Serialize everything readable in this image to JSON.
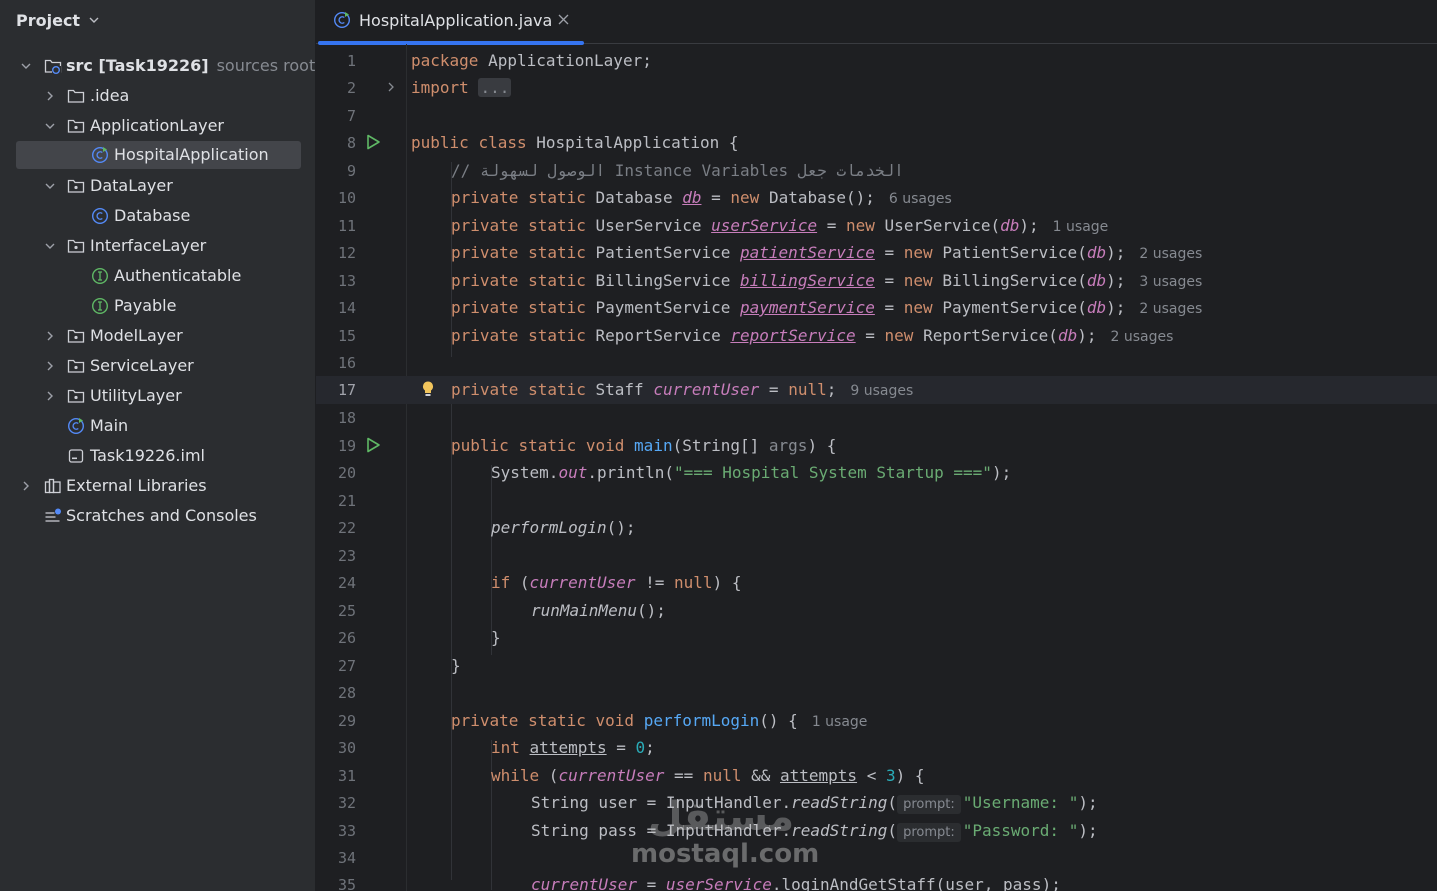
{
  "project_panel": {
    "title": "Project",
    "tree": [
      {
        "label": "src [Task19226]",
        "hint": "sources root,",
        "icon": "source-root-folder-icon",
        "expanded": true
      },
      {
        "label": ".idea",
        "icon": "folder-icon",
        "expanded": false
      },
      {
        "label": "ApplicationLayer",
        "icon": "package-folder-icon",
        "expanded": true
      },
      {
        "label": "HospitalApplication",
        "icon": "java-class-icon",
        "selected": true
      },
      {
        "label": "DataLayer",
        "icon": "package-folder-icon",
        "expanded": true
      },
      {
        "label": "Database",
        "icon": "java-class-icon"
      },
      {
        "label": "InterfaceLayer",
        "icon": "package-folder-icon",
        "expanded": true
      },
      {
        "label": "Authenticatable",
        "icon": "java-interface-icon"
      },
      {
        "label": "Payable",
        "icon": "java-interface-icon"
      },
      {
        "label": "ModelLayer",
        "icon": "package-folder-icon",
        "expanded": false
      },
      {
        "label": "ServiceLayer",
        "icon": "package-folder-icon",
        "expanded": false
      },
      {
        "label": "UtilityLayer",
        "icon": "package-folder-icon",
        "expanded": false
      },
      {
        "label": "Main",
        "icon": "java-main-class-icon"
      },
      {
        "label": "Task19226.iml",
        "icon": "iml-file-icon"
      },
      {
        "label": "External Libraries",
        "icon": "libraries-icon",
        "expanded": false
      },
      {
        "label": "Scratches and Consoles",
        "icon": "scratches-icon"
      }
    ]
  },
  "editor": {
    "tab_label": "HospitalApplication.java",
    "current_line": "17",
    "line_numbers": [
      "1",
      "2",
      "7",
      "8",
      "9",
      "10",
      "11",
      "12",
      "13",
      "14",
      "15",
      "16",
      "17",
      "18",
      "19",
      "20",
      "21",
      "22",
      "23",
      "24",
      "25",
      "26",
      "27",
      "28",
      "29",
      "30",
      "31",
      "32",
      "33",
      "34",
      "35"
    ],
    "code": {
      "package_kw": "package",
      "package_name": "ApplicationLayer;",
      "import_kw": "import",
      "import_fold": "...",
      "l8_public": "public",
      "l8_class": "class",
      "l8_name": "HospitalApplication {",
      "l9_comment": "// الوصول لسهولة Instance Variables الخدمات جعل",
      "private": "private",
      "static": "static",
      "new": "new",
      "l10_type": "Database",
      "l10_var": "db",
      "l10_eq": " = ",
      "l10_call": "Database();",
      "l10_hint": "6 usages",
      "l11_type": "UserService",
      "l11_var": "userService",
      "l11_call": "UserService(",
      "l11_arg": "db",
      "l11_end": ");",
      "l11_hint": "1 usage",
      "l12_type": "PatientService",
      "l12_var": "patientService",
      "l12_call": "PatientService(",
      "l12_arg": "db",
      "l12_end": ");",
      "l12_hint": "2 usages",
      "l13_type": "BillingService",
      "l13_var": "billingService",
      "l13_call": "BillingService(",
      "l13_arg": "db",
      "l13_end": ");",
      "l13_hint": "3 usages",
      "l14_type": "PaymentService",
      "l14_var": "paymentService",
      "l14_call": "PaymentService(",
      "l14_arg": "db",
      "l14_end": ");",
      "l14_hint": "2 usages",
      "l15_type": "ReportService",
      "l15_var": "reportService",
      "l15_call": "ReportService(",
      "l15_arg": "db",
      "l15_end": ");",
      "l15_hint": "2 usages",
      "l17_type": "Staff",
      "l17_var": "currentUser",
      "l17_null": "null",
      "l17_hint": "9 usages",
      "l19_public": "public",
      "l19_void": "void",
      "l19_main": "main",
      "l19_params": "(String[] ",
      "l19_args": "args",
      "l19_end": ") {",
      "l20_sys": "System.",
      "l20_out": "out",
      "l20_print": ".println(",
      "l20_str": "\"=== Hospital System Startup ===\"",
      "l20_end": ");",
      "l22_call": "performLogin",
      "l22_end": "();",
      "l24_if": "if",
      "l24_var": "currentUser",
      "l24_op": " != ",
      "l24_null": "null",
      "l24_end": ") {",
      "l25_call": "runMainMenu",
      "l25_end": "();",
      "l26": "}",
      "l27": "}",
      "l29_void": "void",
      "l29_fn": "performLogin",
      "l29_end": "() {",
      "l29_hint": "1 usage",
      "l30_int": "int",
      "l30_var": "attempts",
      "l30_eq": " = ",
      "l30_num": "0",
      "l30_end": ";",
      "l31_while": "while",
      "l31_var": "currentUser",
      "l31_op": " == ",
      "l31_null": "null",
      "l31_and": " && ",
      "l31_att": "attempts",
      "l31_lt": " < ",
      "l31_num": "3",
      "l31_end": ") {",
      "l32_decl": "String user = InputHandler.",
      "l32_fn": "readString",
      "l32_inlay": "prompt:",
      "l32_str": "\"Username: \"",
      "l32_end": ");",
      "l33_decl": "String pass = InputHandler.",
      "l33_fn": "readString",
      "l33_inlay": "prompt:",
      "l33_str": "\"Password: \"",
      "l33_end": ");",
      "l35_var": "currentUser",
      "l35_eq": " = ",
      "l35_svc": "userService",
      "l35_rest": ".loginAndGetStaff(user, pass);"
    }
  },
  "watermark": {
    "arabic": "مستقل",
    "latin": "mostaql.com"
  },
  "colors": {
    "accent": "#3574f0",
    "keyword": "#cf8e6d",
    "string": "#6aab73",
    "static_field": "#c77dbb",
    "function": "#56a8f5",
    "number": "#2aacb8"
  }
}
